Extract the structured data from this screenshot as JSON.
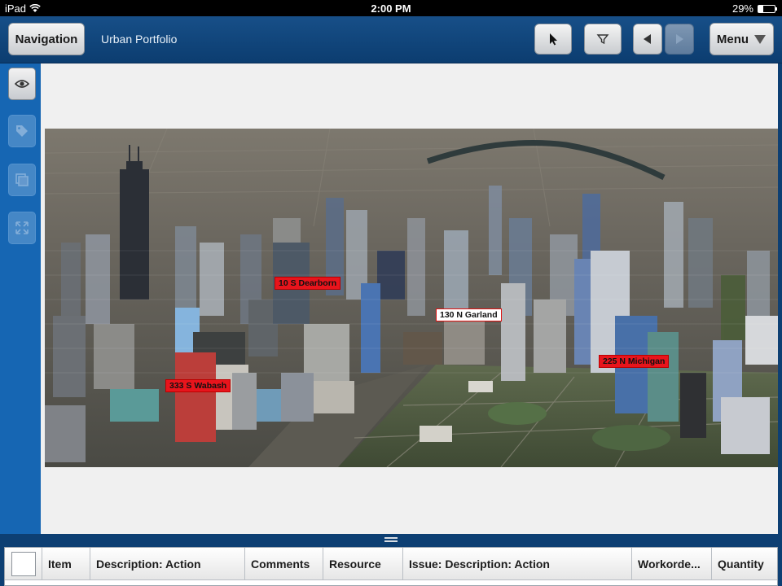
{
  "status_bar": {
    "device": "iPad",
    "time": "2:00 PM",
    "battery": "29%",
    "battery_level": 0.29
  },
  "toolbar": {
    "navigation_label": "Navigation",
    "title": "Urban Portfolio",
    "menu_label": "Menu",
    "icons": [
      "pointer-icon",
      "filter-icon",
      "back-arrow-icon",
      "forward-arrow-icon",
      "menu-chevron-icon"
    ]
  },
  "side_rail": {
    "icons": [
      "eye-icon",
      "tag-icon",
      "layers-icon",
      "expand-icon"
    ]
  },
  "map": {
    "labels": [
      {
        "text": "10 S Dearborn",
        "style": "red"
      },
      {
        "text": "130 N Garland",
        "style": "white"
      },
      {
        "text": "225 N Michigan",
        "style": "red"
      },
      {
        "text": "333 S Wabash",
        "style": "red"
      }
    ]
  },
  "grid": {
    "columns": [
      "Item",
      "Description: Action",
      "Comments",
      "Resource",
      "Issue: Description: Action",
      "Workorde...",
      "Quantity"
    ]
  },
  "colors": {
    "toolbar": "#0c3d70",
    "rail": "#1666b3",
    "label_red": "#e8141c"
  }
}
